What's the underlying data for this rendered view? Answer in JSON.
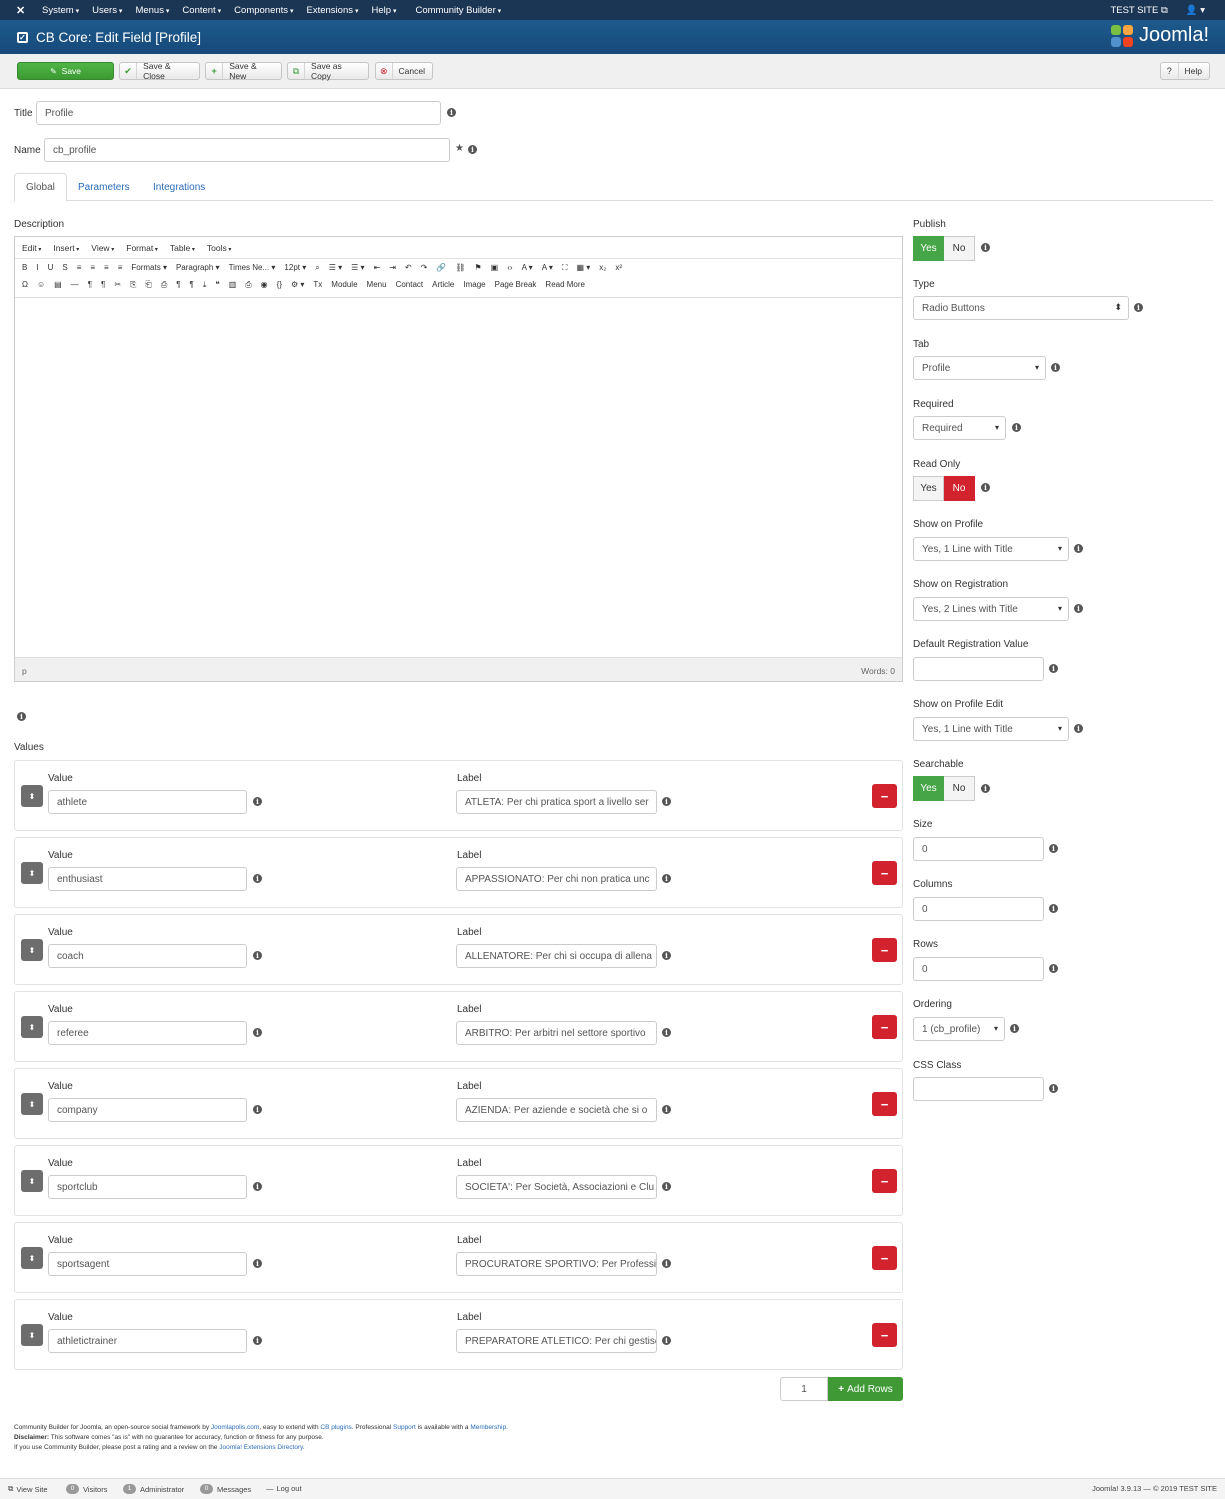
{
  "topnav": {
    "menu": [
      "System",
      "Users",
      "Menus",
      "Content",
      "Components",
      "Extensions",
      "Help",
      "Community Builder"
    ],
    "site_label": "TEST SITE",
    "user_icon": "user-icon"
  },
  "header": {
    "title": "CB Core: Edit Field [Profile]",
    "brand": "Joomla!"
  },
  "toolbar": {
    "save": "Save",
    "save_close": "Save & Close",
    "save_new": "Save & New",
    "save_copy": "Save as Copy",
    "cancel": "Cancel",
    "help": "Help"
  },
  "form": {
    "title_label": "Title",
    "title_value": "Profile",
    "name_label": "Name",
    "name_value": "cb_profile"
  },
  "tabs": [
    "Global",
    "Parameters",
    "Integrations"
  ],
  "editor": {
    "description_label": "Description",
    "menubar": [
      "Edit",
      "Insert",
      "View",
      "Format",
      "Table",
      "Tools"
    ],
    "row1": [
      "B",
      "I",
      "U",
      "S",
      "≡",
      "≡",
      "≡",
      "≡",
      "Formats ▾",
      "Paragraph ▾",
      "Times Ne... ▾",
      "12pt ▾",
      "⌕",
      "☰ ▾",
      "☰ ▾",
      "⇤",
      "⇥",
      "↶",
      "↷",
      "🔗",
      "⛓",
      "⚑",
      "▣",
      "‹›",
      "A ▾",
      "A ▾",
      "⛶",
      "▦ ▾",
      "x₂",
      "x²"
    ],
    "row2": [
      "Ω",
      "☺",
      "▤",
      "—",
      "¶",
      "¶",
      "✂",
      "⎘",
      "⎗",
      "⎙",
      "¶",
      "¶",
      "⤓",
      "❝",
      "▥",
      "⎙",
      "◉",
      "{}",
      "⚙ ▾",
      "Tx",
      "Module",
      "Menu",
      "Contact",
      "Article",
      "Image",
      "Page Break",
      "Read More"
    ],
    "path": "p",
    "words": "Words: 0"
  },
  "values_section": {
    "label": "Values",
    "value_label": "Value",
    "label_label": "Label",
    "rows": [
      {
        "value": "athlete",
        "label": "ATLETA: Per chi pratica sport a livello ser"
      },
      {
        "value": "enthusiast",
        "label": "APPASSIONATO: Per chi non pratica unc"
      },
      {
        "value": "coach",
        "label": "ALLENATORE: Per chi si occupa di allena"
      },
      {
        "value": "referee",
        "label": "ARBITRO: Per arbitri nel settore sportivo"
      },
      {
        "value": "company",
        "label": "AZIENDA: Per aziende e società che si o"
      },
      {
        "value": "sportclub",
        "label": "SOCIETA': Per Società, Associazioni e Clu"
      },
      {
        "value": "sportsagent",
        "label": "PROCURATORE SPORTIVO: Per Professic"
      },
      {
        "value": "athletictrainer",
        "label": "PREPARATORE ATLETICO: Per chi gestisc"
      }
    ],
    "add_count": "1",
    "add_rows": "Add Rows"
  },
  "side": {
    "publish_label": "Publish",
    "yes": "Yes",
    "no": "No",
    "type_label": "Type",
    "type_value": "Radio Buttons",
    "tab_label": "Tab",
    "tab_value": "Profile",
    "required_label": "Required",
    "required_value": "Required",
    "readonly_label": "Read Only",
    "show_profile_label": "Show on Profile",
    "show_profile_value": "Yes, 1 Line with Title",
    "show_reg_label": "Show on Registration",
    "show_reg_value": "Yes, 2 Lines with Title",
    "default_reg_label": "Default Registration Value",
    "default_reg_value": "",
    "show_edit_label": "Show on Profile Edit",
    "show_edit_value": "Yes, 1 Line with Title",
    "searchable_label": "Searchable",
    "size_label": "Size",
    "size_value": "0",
    "columns_label": "Columns",
    "columns_value": "0",
    "rows_label": "Rows",
    "rows_value": "0",
    "ordering_label": "Ordering",
    "ordering_value": "1 (cb_profile)",
    "css_label": "CSS Class",
    "css_value": ""
  },
  "footer": {
    "line1_a": "Community Builder for Joomla, an open-source social framework by ",
    "line1_link1": "Joomlapolis.com",
    "line1_b": ", easy to extend with ",
    "line1_link2": "CB plugins",
    "line1_c": ". Professional ",
    "line1_link3": "Support",
    "line1_d": " is available with a ",
    "line1_link4": "Membership",
    "line1_e": ".",
    "line2_bold": "Disclaimer:",
    "line2": " This software comes \"as is\" with no guarantee for accuracy, function or fitness for any purpose.",
    "line3_a": "If you use Community Builder, please post a rating and a review on the ",
    "line3_link": "Joomla! Extensions Directory",
    "line3_b": "."
  },
  "statusbar": {
    "view_site": "View Site",
    "visitors_count": "0",
    "visitors": "Visitors",
    "admin_count": "1",
    "admin": "Administrator",
    "messages_count": "0",
    "messages": "Messages",
    "logout": "Log out",
    "version": "Joomla! 3.9.13 — © 2019 TEST SITE"
  }
}
